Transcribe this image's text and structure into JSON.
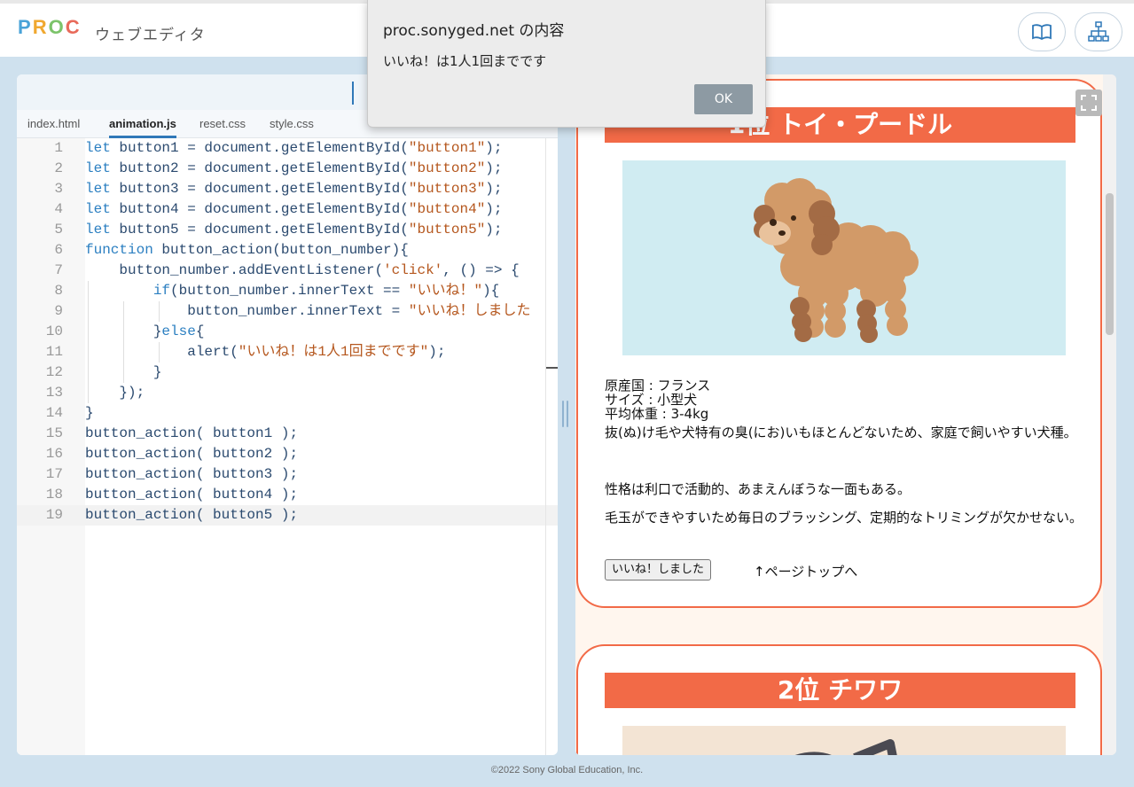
{
  "header": {
    "logo": {
      "p": "P",
      "r": "R",
      "o": "O",
      "c": "C"
    },
    "app_name": "ウェブエディタ",
    "buttons": [
      {
        "name": "book-icon"
      },
      {
        "name": "sitemap-icon"
      }
    ]
  },
  "editor": {
    "tabs": [
      {
        "label": "index.html",
        "active": false
      },
      {
        "label": "animation.js",
        "active": true
      },
      {
        "label": "reset.css",
        "active": false
      },
      {
        "label": "style.css",
        "active": false
      }
    ],
    "lines": [
      {
        "n": "1",
        "parts": [
          [
            "kw",
            "let"
          ],
          [
            "p",
            " button1 = document.getElementById("
          ],
          [
            "str",
            "\"button1\""
          ],
          [
            "p",
            ");"
          ]
        ]
      },
      {
        "n": "2",
        "parts": [
          [
            "kw",
            "let"
          ],
          [
            "p",
            " button2 = document.getElementById("
          ],
          [
            "str",
            "\"button2\""
          ],
          [
            "p",
            ");"
          ]
        ]
      },
      {
        "n": "3",
        "parts": [
          [
            "kw",
            "let"
          ],
          [
            "p",
            " button3 = document.getElementById("
          ],
          [
            "str",
            "\"button3\""
          ],
          [
            "p",
            ");"
          ]
        ]
      },
      {
        "n": "4",
        "parts": [
          [
            "kw",
            "let"
          ],
          [
            "p",
            " button4 = document.getElementById("
          ],
          [
            "str",
            "\"button4\""
          ],
          [
            "p",
            ");"
          ]
        ]
      },
      {
        "n": "5",
        "parts": [
          [
            "kw",
            "let"
          ],
          [
            "p",
            " button5 = document.getElementById("
          ],
          [
            "str",
            "\"button5\""
          ],
          [
            "p",
            ");"
          ]
        ]
      },
      {
        "n": "6",
        "parts": [
          [
            "kw",
            "function"
          ],
          [
            "p",
            " button_action(button_number){"
          ]
        ]
      },
      {
        "n": "7",
        "parts": [
          [
            "p",
            "    button_number.addEventListener("
          ],
          [
            "str",
            "'click'"
          ],
          [
            "p",
            ", () => {"
          ]
        ]
      },
      {
        "n": "8",
        "parts": [
          [
            "p",
            "        "
          ],
          [
            "kw",
            "if"
          ],
          [
            "p",
            "(button_number.innerText == "
          ],
          [
            "str",
            "\"いいね！\""
          ],
          [
            "p",
            "){"
          ]
        ]
      },
      {
        "n": "9",
        "parts": [
          [
            "p",
            "            button_number.innerText = "
          ],
          [
            "str",
            "\"いいね！しました"
          ]
        ]
      },
      {
        "n": "10",
        "parts": [
          [
            "p",
            "        }"
          ],
          [
            "kw",
            "else"
          ],
          [
            "p",
            "{"
          ]
        ]
      },
      {
        "n": "11",
        "parts": [
          [
            "p",
            "            alert("
          ],
          [
            "str",
            "\"いいね！は1人1回までです\""
          ],
          [
            "p",
            ");"
          ]
        ]
      },
      {
        "n": "12",
        "parts": [
          [
            "p",
            "        }"
          ]
        ]
      },
      {
        "n": "13",
        "parts": [
          [
            "p",
            "    });"
          ]
        ]
      },
      {
        "n": "14",
        "parts": [
          [
            "p",
            "}"
          ]
        ]
      },
      {
        "n": "15",
        "parts": [
          [
            "p",
            "button_action( button1 );"
          ]
        ]
      },
      {
        "n": "16",
        "parts": [
          [
            "p",
            "button_action( button2 );"
          ]
        ]
      },
      {
        "n": "17",
        "parts": [
          [
            "p",
            "button_action( button3 );"
          ]
        ]
      },
      {
        "n": "18",
        "parts": [
          [
            "p",
            "button_action( button4 );"
          ]
        ]
      },
      {
        "n": "19",
        "parts": [
          [
            "p",
            "button_action( button5 );"
          ]
        ]
      }
    ]
  },
  "preview": {
    "card1": {
      "title": "1位 トイ・プードル",
      "origin": "原産国 : フランス",
      "size": "サイズ : 小型犬",
      "weight": "平均体重 : 3-4kg",
      "desc1": "抜(ぬ)け毛や犬特有の臭(にお)いもほとんどないため、家庭で飼いやすい犬種。",
      "desc2": "性格は利口で活動的、あまえんぼうな一面もある。",
      "desc3": "毛玉ができやすいため毎日のブラッシング、定期的なトリミングが欠かせない。",
      "like_button": "いいね！しました",
      "top_link": "↑ページトップへ"
    },
    "card2": {
      "title": "2位 チワワ"
    }
  },
  "footer": "©2022 Sony Global Education, Inc.",
  "dialog": {
    "title": "proc.sonyged.net の内容",
    "message": "いいね！は1人1回までです",
    "ok": "OK"
  }
}
